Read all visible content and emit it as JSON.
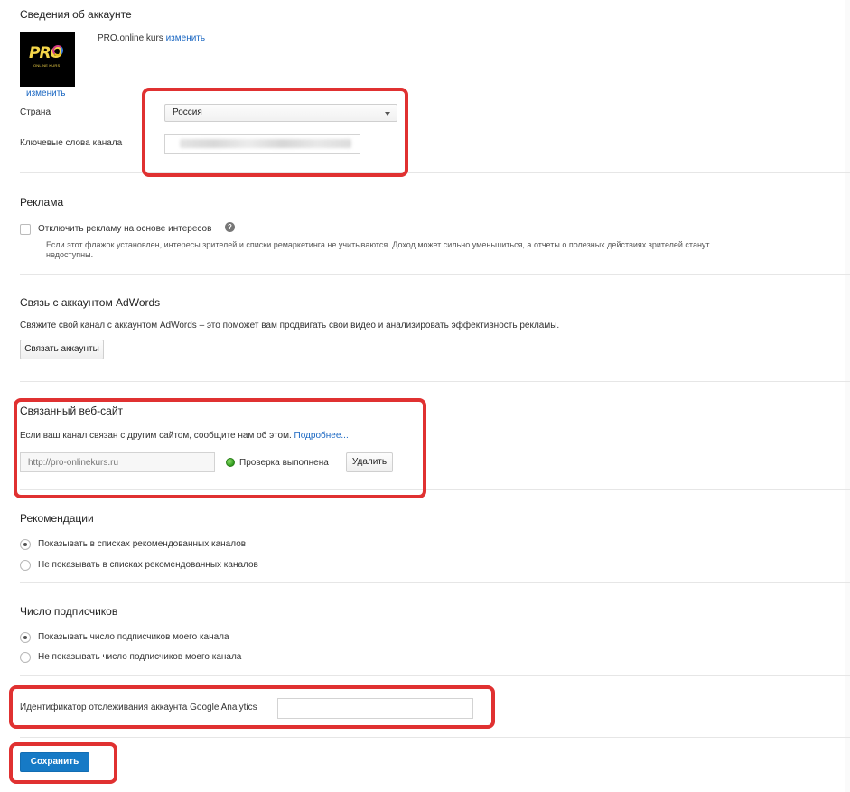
{
  "account": {
    "title": "Сведения об аккаунте",
    "channel_name": "PRO.online kurs",
    "change_name_link": "изменить",
    "change_avatar_link": "изменить",
    "avatar_logo_text": "PRO",
    "avatar_sub_text": "ONLINE KURS",
    "country_label": "Страна",
    "country_value": "Россия",
    "keywords_label": "Ключевые слова канала"
  },
  "ads": {
    "title": "Реклама",
    "checkbox_label": "Отключить рекламу на основе интересов",
    "help_icon": "?",
    "description": "Если этот флажок установлен, интересы зрителей и списки ремаркетинга не учитываются. Доход может сильно уменьшиться, а отчеты о полезных действиях зрителей станут недоступны."
  },
  "adwords": {
    "title": "Связь с аккаунтом AdWords",
    "description": "Свяжите свой канал с аккаунтом AdWords – это поможет вам продвигать свои видео и анализировать эффективность рекламы.",
    "button_label": "Связать аккаунты"
  },
  "website": {
    "title": "Связанный веб-сайт",
    "description": "Если ваш канал связан с другим сайтом, сообщите нам об этом.",
    "more_link": "Подробнее...",
    "url_placeholder": "http://pro-onlinekurs.ru",
    "status_text": "Проверка выполнена",
    "delete_button": "Удалить"
  },
  "recommendations": {
    "title": "Рекомендации",
    "option_show": "Показывать в списках рекомендованных каналов",
    "option_hide": "Не показывать в списках рекомендованных каналов",
    "selected": "show"
  },
  "subscribers": {
    "title": "Число подписчиков",
    "option_show": "Показывать число подписчиков моего канала",
    "option_hide": "Не показывать число подписчиков моего канала",
    "selected": "show"
  },
  "analytics": {
    "label": "Идентификатор отслеживания аккаунта Google Analytics",
    "value": ""
  },
  "save_button": "Сохранить",
  "colors": {
    "accent": "#167ac6",
    "link": "#1a67c2",
    "highlight": "#e03131",
    "status_ok": "#2f9a1e"
  }
}
